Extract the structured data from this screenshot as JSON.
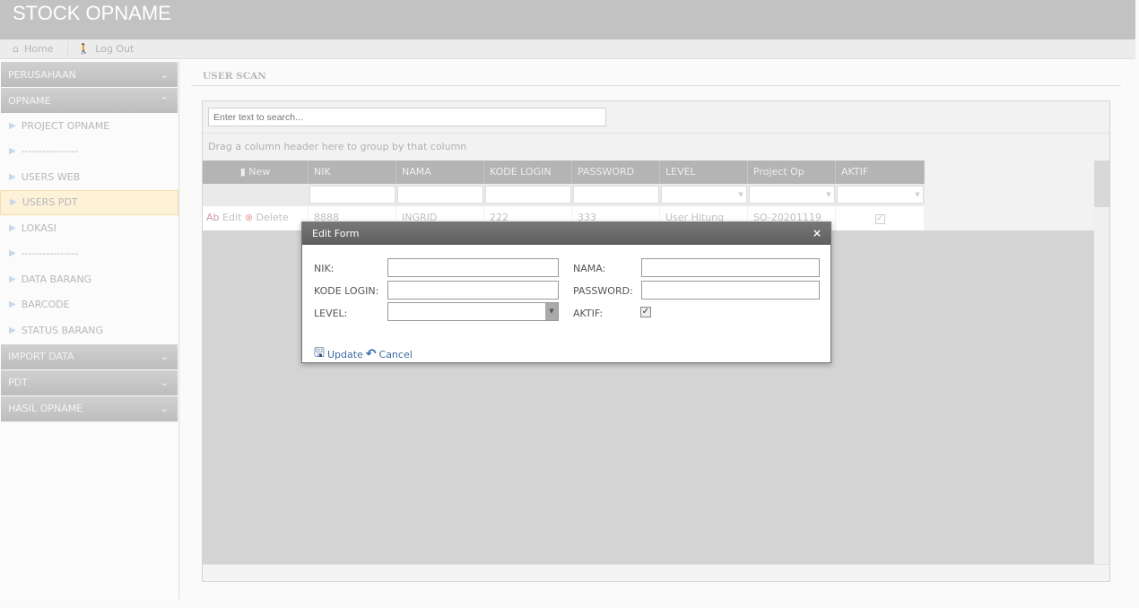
{
  "app": {
    "title": "STOCK OPNAME"
  },
  "toolbar": {
    "home": "Home",
    "logout": "Log Out"
  },
  "sidebar": {
    "perusahaan": "PERUSAHAAN",
    "opname": "OPNAME",
    "items": [
      "PROJECT OPNAME",
      "----------------",
      "USERS WEB",
      "USERS PDT",
      "LOKASI",
      "----------------",
      "DATA BARANG",
      "BARCODE",
      "STATUS BARANG"
    ],
    "selected": "USERS PDT",
    "import": "IMPORT DATA",
    "pdt": "PDT",
    "hasil": "HASIL OPNAME"
  },
  "page": {
    "title": "USER SCAN"
  },
  "grid": {
    "search_placeholder": "Enter text to search...",
    "group_hint": "Drag a column header here to group by that column",
    "new_label": "New",
    "columns": [
      "NIK",
      "NAMA",
      "KODE LOGIN",
      "PASSWORD",
      "LEVEL",
      "Project Op",
      "AKTIF"
    ],
    "row": {
      "edit": "Edit",
      "delete": "Delete",
      "nik": "8888",
      "nama": "INGRID",
      "kode_login": "222",
      "password": "333",
      "level": "User Hitung",
      "project": "SO-20201119",
      "aktif": true
    }
  },
  "modal": {
    "title": "Edit Form",
    "nik": "NIK:",
    "nama": "NAMA:",
    "kode_login": "KODE LOGIN:",
    "password": "PASSWORD:",
    "level": "LEVEL:",
    "aktif": "AKTIF:",
    "aktif_checked": true,
    "update": "Update",
    "cancel": "Cancel"
  }
}
